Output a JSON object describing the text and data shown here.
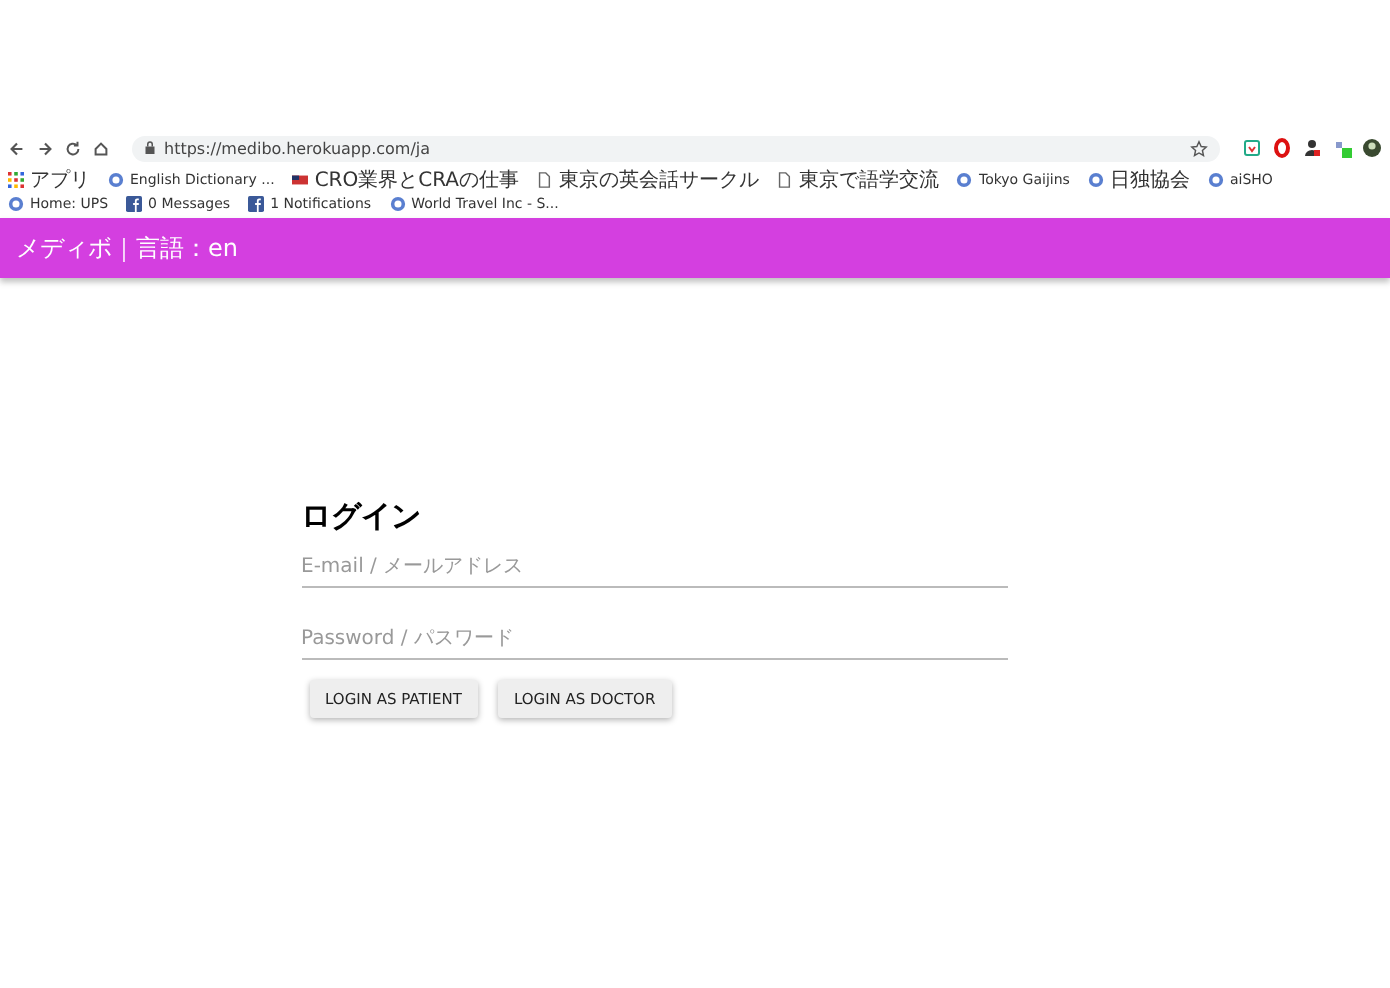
{
  "browser": {
    "url": "https://medibo.herokuapp.com/ja",
    "bookmarks": [
      {
        "label": "アプリ",
        "kind": "apps"
      },
      {
        "label": "English Dictionary ...",
        "kind": "site"
      },
      {
        "label": "CRO業界とCRAの仕事",
        "kind": "flag"
      },
      {
        "label": "東京の英会話サークル",
        "kind": "page"
      },
      {
        "label": "東京で語学交流",
        "kind": "page"
      },
      {
        "label": "Tokyo Gaijins",
        "kind": "site"
      },
      {
        "label": "日独協会",
        "kind": "site"
      },
      {
        "label": "aiSHO",
        "kind": "site"
      },
      {
        "label": "Home: UPS",
        "kind": "site"
      },
      {
        "label": "0 Messages",
        "kind": "facebook"
      },
      {
        "label": "1 Notifications",
        "kind": "facebook"
      },
      {
        "label": "World Travel Inc - S...",
        "kind": "site"
      }
    ]
  },
  "app_bar": {
    "title": "メディボ｜言語：en"
  },
  "login": {
    "heading": "ログイン",
    "fields": [
      {
        "placeholder": "E-mail / メールアドレス"
      },
      {
        "placeholder": "Password / パスワード"
      }
    ],
    "buttons": [
      "LOGIN AS PATIENT",
      "LOGIN AS DOCTOR"
    ]
  }
}
